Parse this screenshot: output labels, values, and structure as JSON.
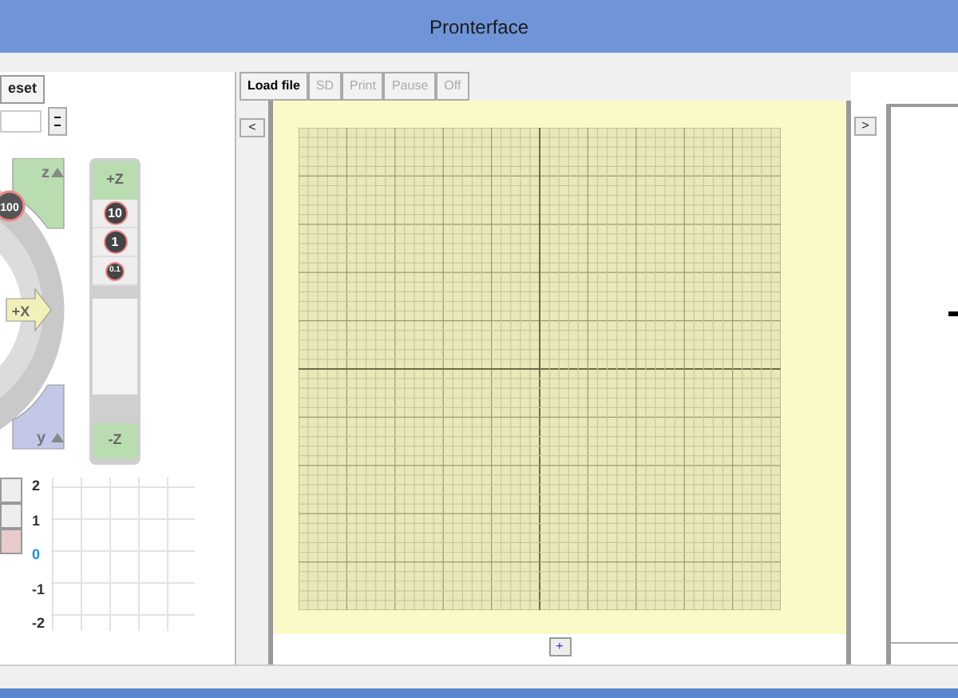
{
  "window": {
    "title": "Pronterface"
  },
  "left_panel": {
    "reset_button": "eset",
    "jog": {
      "xy_step": "100",
      "x_button": "+X",
      "z_home": "z",
      "y_home": "y"
    },
    "z_column": {
      "up": "+Z",
      "steps": [
        "10",
        "1",
        "0.1"
      ],
      "down": "-Z"
    },
    "graph": {
      "labels": [
        "2",
        "1",
        "0",
        "-1",
        "-2"
      ]
    }
  },
  "toolbar": [
    {
      "label": "Load file",
      "disabled": false
    },
    {
      "label": "SD",
      "disabled": true
    },
    {
      "label": "Print",
      "disabled": true
    },
    {
      "label": "Pause",
      "disabled": true
    },
    {
      "label": "Off",
      "disabled": true
    }
  ],
  "center": {
    "collapse_button": "<",
    "add_button": "+"
  },
  "right_panel": {
    "expand_button": ">"
  }
}
